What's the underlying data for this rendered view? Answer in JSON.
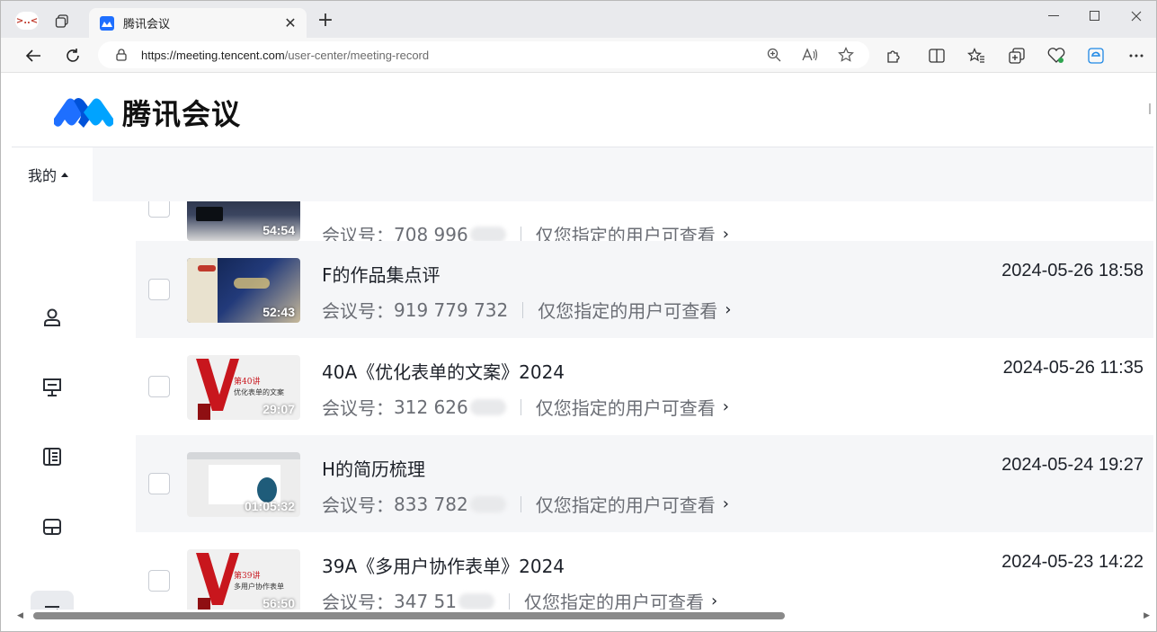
{
  "browser": {
    "tab_title": "腾讯会议",
    "app_icon_text": ">..<",
    "url_host": "https://meeting.tencent.com",
    "url_path": "/user-center/meeting-record"
  },
  "header": {
    "logo_text": "腾讯会议",
    "brand_color": "#1e6fff"
  },
  "sidebar": {
    "mine_label": "我的",
    "items": [
      {
        "name": "user-icon",
        "active": false
      },
      {
        "name": "presentation-icon",
        "active": false
      },
      {
        "name": "document-list-icon",
        "active": false
      },
      {
        "name": "layout-icon",
        "active": false
      },
      {
        "name": "records-list-icon",
        "active": true
      }
    ]
  },
  "recordings": [
    {
      "title": "",
      "meeting_id_label": "会议号：",
      "meeting_id": "708 996",
      "access": "仅您指定的用户可查看",
      "date": "",
      "duration": "54:54"
    },
    {
      "title": "F的作品集点评",
      "meeting_id_label": "会议号：",
      "meeting_id": "919 779 732",
      "access": "仅您指定的用户可查看",
      "date": "2024-05-26 18:58",
      "duration": "52:43"
    },
    {
      "title": "40A《优化表单的文案》2024",
      "meeting_id_label": "会议号：",
      "meeting_id": "312 626",
      "access": "仅您指定的用户可查看",
      "date": "2024-05-26 11:35",
      "duration": "29:07"
    },
    {
      "title": "H的简历梳理",
      "meeting_id_label": "会议号：",
      "meeting_id": "833 782",
      "access": "仅您指定的用户可查看",
      "date": "2024-05-24 19:27",
      "duration": "01:05:32"
    },
    {
      "title": "39A《多用户协作表单》2024",
      "meeting_id_label": "会议号：",
      "meeting_id": "347 51",
      "access": "仅您指定的用户可查看",
      "date": "2024-05-23 14:22",
      "duration": "56:50"
    }
  ],
  "thumb_text": {
    "v40_title": "第40讲",
    "v40_sub": "优化表单的文案",
    "v39_title": "第39讲",
    "v39_sub": "多用户协作表单"
  }
}
